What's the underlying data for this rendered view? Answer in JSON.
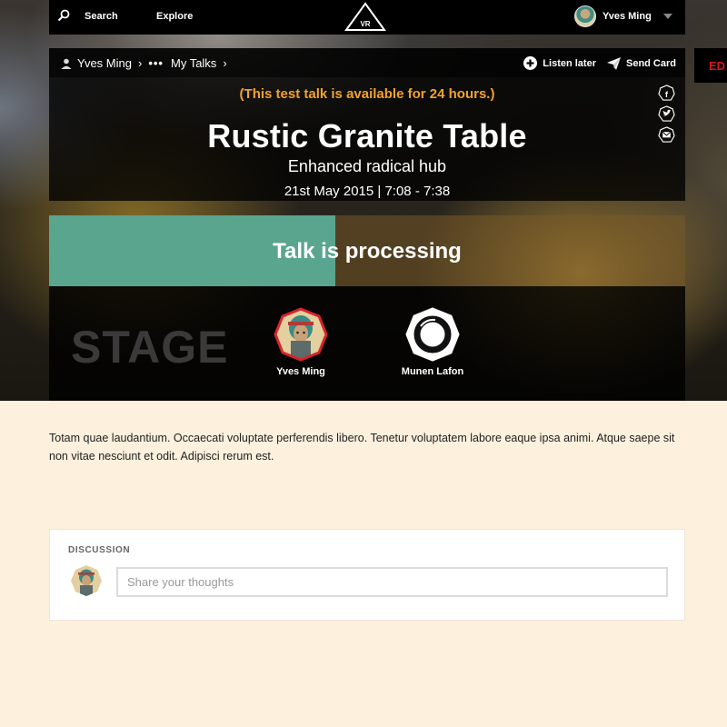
{
  "topnav": {
    "search_label": "Search",
    "explore_label": "Explore",
    "logo_text": "VR",
    "user_name": "Yves Ming"
  },
  "breadcrumb": {
    "user": "Yves Ming",
    "more": "•••",
    "section": "My Talks"
  },
  "actions": {
    "listen_later": "Listen later",
    "send_card": "Send Card"
  },
  "talk": {
    "notice": "(This test talk is available for 24 hours.)",
    "title": "Rustic Granite Table",
    "subtitle": "Enhanced radical hub",
    "date": "21st May 2015 | 7:08 - 7:38"
  },
  "edit_tab": "ED",
  "processing": {
    "label": "Talk is processing",
    "progress_percent": 45,
    "fill_color": "#5aa58e"
  },
  "stage": {
    "title": "STAGE",
    "speakers": [
      {
        "name": "Yves Ming",
        "icon": "avatar-portrait",
        "ring_color": "#d8232a"
      },
      {
        "name": "Munen Lafon",
        "icon": "avatar-ink-circle",
        "ring_color": "#ffffff"
      }
    ]
  },
  "description": "Totam quae laudantium. Occaecati voluptate perferendis libero. Tenetur voluptatem labore eaque ipsa animi. Atque saepe sit non vitae nesciunt et odit. Adipisci rerum est.",
  "discussion": {
    "heading": "DISCUSSION",
    "placeholder": "Share your thoughts"
  },
  "colors": {
    "notice": "#f2a22a",
    "page_background": "#fdf0dd",
    "edit": "#d8161b"
  }
}
